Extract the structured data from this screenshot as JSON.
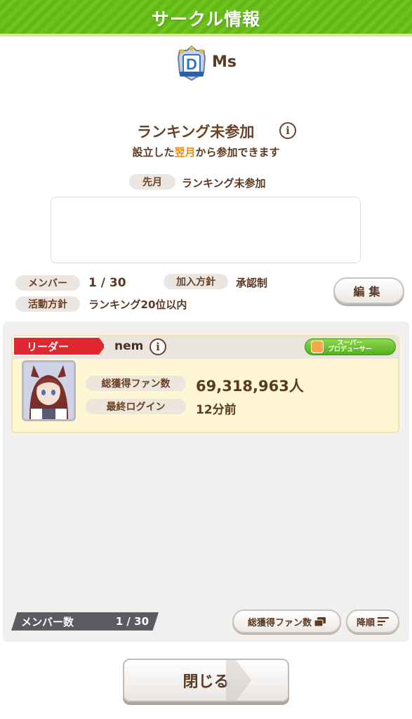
{
  "header": {
    "title": "サークル情報"
  },
  "circle": {
    "rank": "D",
    "name": "Ms"
  },
  "ranking": {
    "title": "ランキング未参加",
    "sub_before": "設立した",
    "sub_highlight": "翌月",
    "sub_after": "から参加できます",
    "last_month_label": "先月",
    "last_month_value": "ランキング未参加"
  },
  "info": {
    "members_label": "メンバー",
    "members_value": "1 / 30",
    "join_policy_label": "加入方針",
    "join_policy_value": "承認制",
    "activity_label": "活動方針",
    "activity_value": "ランキング20位以内",
    "edit_button": "編集"
  },
  "member": {
    "role": "リーダー",
    "name": "nem",
    "badge_line1": "スーパー",
    "badge_line2": "プロデューサー",
    "fans_label": "総獲得ファン数",
    "fans_value": "69,318,963人",
    "login_label": "最終ログイン",
    "login_value": "12分前"
  },
  "footer": {
    "count_label": "メンバー数",
    "count_value": "1 / 30",
    "sort_button": "総獲得ファン数",
    "order_button": "降順",
    "close_button": "閉じる"
  },
  "colors": {
    "header_green": "#6fc21f",
    "leader_red": "#e0262f",
    "highlight_orange": "#f08a0c"
  }
}
